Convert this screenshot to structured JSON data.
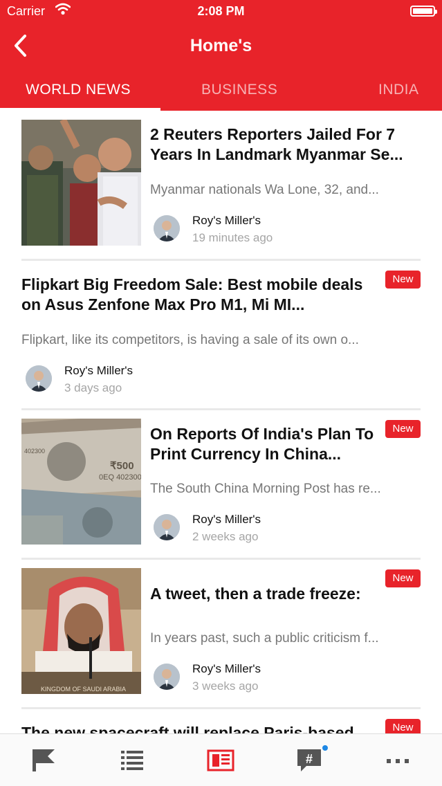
{
  "status_bar": {
    "carrier": "Carrier",
    "time": "2:08 PM"
  },
  "header": {
    "title": "Home's"
  },
  "tabs": [
    {
      "label": "WORLD NEWS",
      "active": true
    },
    {
      "label": "BUSINESS",
      "active": false
    },
    {
      "label": "INDIA",
      "active": false
    }
  ],
  "articles": [
    {
      "headline": "2 Reuters Reporters Jailed For 7 Years In Landmark Myanmar Se...",
      "summary": "Myanmar nationals Wa Lone, 32, and...",
      "author": "Roy's Miller's",
      "time_ago": "19 minutes ago",
      "badge": ""
    },
    {
      "headline": "Flipkart Big Freedom Sale: Best mobile deals on Asus Zenfone Max Pro M1, Mi MI...",
      "summary": "Flipkart, like its competitors, is having a sale of its own o...",
      "author": "Roy's Miller's",
      "time_ago": "3 days ago",
      "badge": "New"
    },
    {
      "headline": "On Reports Of India's Plan To Print Currency In China...",
      "summary": "The South China Morning Post has re...",
      "author": "Roy's Miller's",
      "time_ago": "2 weeks ago",
      "badge": "New"
    },
    {
      "headline": "A tweet, then a trade freeze:",
      "summary": "In years past, such a public criticism f...",
      "author": "Roy's Miller's",
      "time_ago": "3 weeks ago",
      "badge": "New"
    },
    {
      "headline": "The new spacecraft will replace Paris-based",
      "badge": "New"
    }
  ],
  "thumbnail_text": {
    "currency_note": "₹500",
    "currency_serial": "0EQ 402300",
    "currency_small": "402300",
    "podium_sign": "KINGDOM OF SAUDI ARABIA"
  },
  "bottom_nav": [
    {
      "icon": "flag-icon",
      "active": false
    },
    {
      "icon": "list-icon",
      "active": false
    },
    {
      "icon": "news-grid-icon",
      "active": true
    },
    {
      "icon": "hashtag-chat-icon",
      "active": false,
      "notification": true
    },
    {
      "icon": "more-icon",
      "active": false
    }
  ],
  "colors": {
    "brand": "#e8232a",
    "muted": "#777777",
    "time": "#a5a5a5",
    "notification": "#1e88e5"
  }
}
